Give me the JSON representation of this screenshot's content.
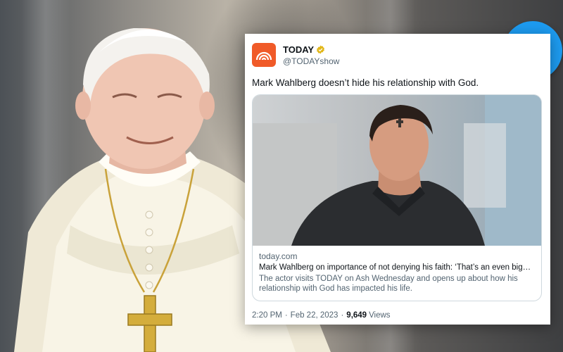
{
  "tweet": {
    "display_name": "TODAY",
    "handle": "@TODAYshow",
    "verified_icon": "verified-badge-icon",
    "text": "Mark Wahlberg doesn’t hide his relationship with God.",
    "card": {
      "domain": "today.com",
      "title": "Mark Wahlberg on importance of not denying his faith: ‘That’s an even bigger ...",
      "description": "The actor visits TODAY on Ash Wednesday and opens up about how his relationship with God has impacted his life."
    },
    "time": "2:20 PM",
    "separator": "·",
    "date": "Feb 22, 2023",
    "views_count": "9,649",
    "views_label": "Views"
  },
  "colors": {
    "twitter_blue": "#1d9bf0",
    "today_orange": "#f05a28",
    "verified_gold": "#e2b719",
    "muted_text": "#536471"
  },
  "icons": [
    "twitter-bird-icon",
    "today-rainbow-logo",
    "verified-badge-icon"
  ]
}
